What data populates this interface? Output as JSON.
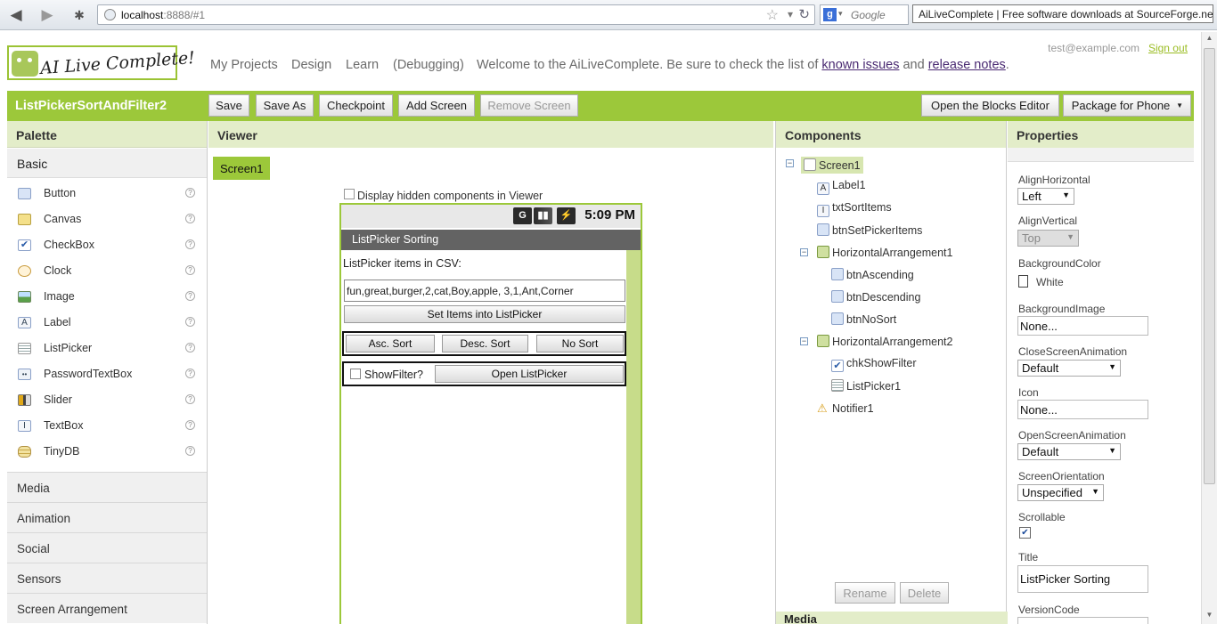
{
  "browser": {
    "url_host": "localhost",
    "url_rest": ":8888/#1",
    "search_placeholder": "Google",
    "tooltip": "AiLiveComplete | Free software downloads at SourceForge.net"
  },
  "header": {
    "logo_text": "AI Live Complete!",
    "nav": {
      "my_projects": "My Projects",
      "design": "Design",
      "learn": "Learn",
      "debugging": "(Debugging)",
      "welcome": "Welcome to the AiLiveComplete. Be sure to check the list of",
      "known_issues": "known issues",
      "and": "and",
      "release_notes": "release notes",
      "period": "."
    },
    "user_email": "test@example.com",
    "sign_out": "Sign out"
  },
  "toolbar": {
    "project_name": "ListPickerSortAndFilter2",
    "save": "Save",
    "save_as": "Save As",
    "checkpoint": "Checkpoint",
    "add_screen": "Add Screen",
    "remove_screen": "Remove Screen",
    "open_blocks": "Open the Blocks Editor",
    "package": "Package for Phone",
    "package_arrow": "▼"
  },
  "palette": {
    "title": "Palette",
    "basic": "Basic",
    "items": [
      {
        "label": "Button",
        "help": "?"
      },
      {
        "label": "Canvas",
        "help": "?"
      },
      {
        "label": "CheckBox",
        "help": "?"
      },
      {
        "label": "Clock",
        "help": "?"
      },
      {
        "label": "Image",
        "help": "?"
      },
      {
        "label": "Label",
        "help": "?"
      },
      {
        "label": "ListPicker",
        "help": "?"
      },
      {
        "label": "PasswordTextBox",
        "help": "?"
      },
      {
        "label": "Slider",
        "help": "?"
      },
      {
        "label": "TextBox",
        "help": "?"
      },
      {
        "label": "TinyDB",
        "help": "?"
      }
    ],
    "categories": [
      "Media",
      "Animation",
      "Social",
      "Sensors",
      "Screen Arrangement"
    ]
  },
  "viewer": {
    "title": "Viewer",
    "screen_tab": "Screen1",
    "hidden_components": "Display hidden components in Viewer",
    "phone": {
      "time": "5:09 PM",
      "title": "ListPicker Sorting",
      "csv_label": "ListPicker items in CSV:",
      "csv_value": "fun,great,burger,2,cat,Boy,apple, 3,1,Ant,Corner",
      "set_items": "Set Items into ListPicker",
      "asc": "Asc. Sort",
      "desc": "Desc. Sort",
      "nosort": "No Sort",
      "show_filter": "ShowFilter?",
      "open_listpicker": "Open ListPicker"
    }
  },
  "components": {
    "title": "Components",
    "tree": {
      "screen1": "Screen1",
      "label1": "Label1",
      "txtsort": "txtSortItems",
      "btnset": "btnSetPickerItems",
      "ha1": "HorizontalArrangement1",
      "btnasc": "btnAscending",
      "btndesc": "btnDescending",
      "btnno": "btnNoSort",
      "ha2": "HorizontalArrangement2",
      "chk": "chkShowFilter",
      "lp": "ListPicker1",
      "notifier": "Notifier1"
    },
    "rename": "Rename",
    "delete": "Delete",
    "media_peek": "Media"
  },
  "properties": {
    "title": "Properties",
    "align_h_label": "AlignHorizontal",
    "align_h": "Left",
    "align_v_label": "AlignVertical",
    "align_v": "Top",
    "bg_color_label": "BackgroundColor",
    "bg_color": "White",
    "bg_image_label": "BackgroundImage",
    "bg_image": "None...",
    "close_anim_label": "CloseScreenAnimation",
    "close_anim": "Default",
    "icon_label": "Icon",
    "icon": "None...",
    "open_anim_label": "OpenScreenAnimation",
    "open_anim": "Default",
    "orientation_label": "ScreenOrientation",
    "orientation": "Unspecified",
    "scrollable_label": "Scrollable",
    "scrollable_checked": true,
    "title_label": "Title",
    "title_value": "ListPicker Sorting",
    "version_label": "VersionCode"
  },
  "colors": {
    "brand_green": "#9cc83a",
    "panel_header": "#e3edc9",
    "link_purple": "#4a2a72"
  }
}
